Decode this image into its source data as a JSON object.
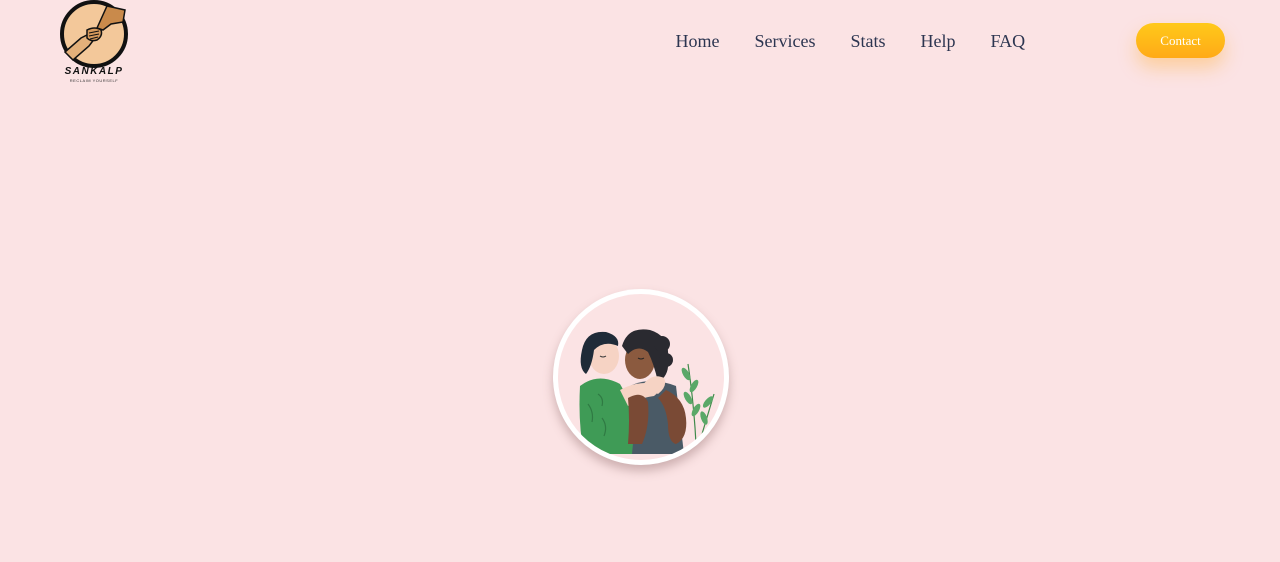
{
  "brand": {
    "name": "SANKALP",
    "tagline": "RECLAIM YOURSELF"
  },
  "nav": {
    "items": [
      {
        "label": "Home"
      },
      {
        "label": "Services"
      },
      {
        "label": "Stats"
      },
      {
        "label": "Help"
      },
      {
        "label": "FAQ"
      }
    ]
  },
  "header": {
    "contact_label": "Contact"
  },
  "colors": {
    "background": "#fbe3e4",
    "nav_text": "#2c3550",
    "accent": "#ffb418",
    "button_text": "#ffffff"
  },
  "hero": {
    "illustration": "two-people-hugging-illustration"
  }
}
